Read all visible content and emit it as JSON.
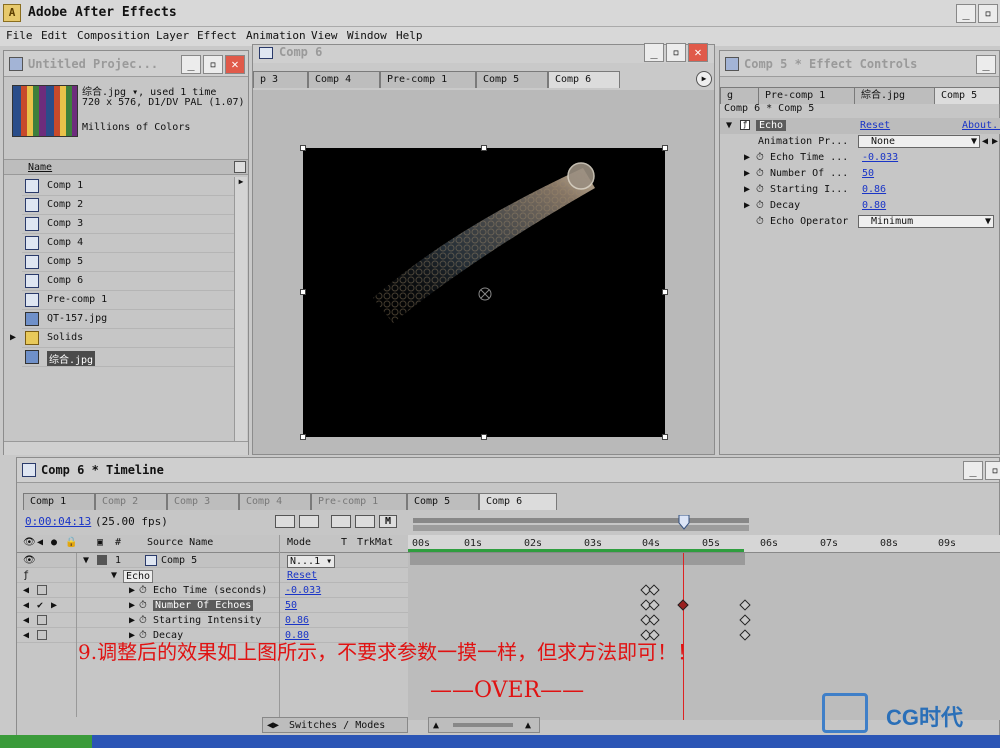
{
  "app": {
    "title": "Adobe After Effects"
  },
  "menu": [
    "File",
    "Edit",
    "Composition",
    "Layer",
    "Effect",
    "Animation",
    "View",
    "Window",
    "Help"
  ],
  "project": {
    "title": "Untitled Projec...",
    "thumb_line1": "综合.jpg ▾, used 1 time",
    "thumb_line2": "720 x 576, D1/DV PAL (1.07)",
    "thumb_line3": "Millions of Colors",
    "col_name": "Name",
    "items": [
      "Comp 1",
      "Comp 2",
      "Comp 3",
      "Comp 4",
      "Comp 5",
      "Comp 6",
      "Pre-comp 1",
      "QT-157.jpg",
      "Solids",
      "综合.jpg"
    ]
  },
  "viewer": {
    "title": "Comp 6",
    "tabs": [
      "p 3",
      "Comp 4",
      "Pre-comp 1",
      "Comp 5",
      "Comp 6"
    ]
  },
  "effect": {
    "title": "Comp 5 * Effect Controls",
    "tabs": [
      "g",
      "Pre-comp 1",
      "綜合.jpg",
      "Comp 5"
    ],
    "breadcrumb": "Comp 6 * Comp 5",
    "effect_name": "Echo",
    "reset": "Reset",
    "about": "About...",
    "rows": [
      {
        "label": "Animation Pr...",
        "value": "None",
        "kind": "dropdown"
      },
      {
        "label": "Echo Time ...",
        "value": "-0.033",
        "kind": "value"
      },
      {
        "label": "Number Of ...",
        "value": "50",
        "kind": "value"
      },
      {
        "label": "Starting I...",
        "value": "0.86",
        "kind": "value"
      },
      {
        "label": "Decay",
        "value": "0.80",
        "kind": "value"
      },
      {
        "label": "Echo Operator",
        "value": "Minimum",
        "kind": "dropdown"
      }
    ]
  },
  "timeline": {
    "title": "Comp 6 * Timeline",
    "tabs": [
      "Comp 1",
      "Comp 2",
      "Comp 3",
      "Comp 4",
      "Pre-comp 1",
      "Comp 5",
      "Comp 6"
    ],
    "timecode": "0:00:04:13",
    "fps": "(25.00 fps)",
    "col_source": "Source Name",
    "col_mode": "Mode",
    "col_t": "T",
    "col_trkmat": "TrkMat",
    "hash": "#",
    "layer_num": "1",
    "layer_name": "Comp 5",
    "layer_mode": "N...1 ▾",
    "effect_name": "Echo",
    "reset": "Reset",
    "props": [
      {
        "name": "Echo Time (seconds)",
        "value": "-0.033"
      },
      {
        "name": "Number Of Echoes",
        "value": "50"
      },
      {
        "name": "Starting Intensity",
        "value": "0.86"
      },
      {
        "name": "Decay",
        "value": "0.80"
      }
    ],
    "ruler": [
      "00s",
      "01s",
      "02s",
      "03s",
      "04s",
      "05s",
      "06s",
      "07s",
      "08s",
      "09s"
    ],
    "switches": "Switches / Modes"
  },
  "overlay": {
    "note": "9.调整后的效果如上图所示，不要求参数一摸一样，但求方法即可！！",
    "over": "——OVER——",
    "brand": "CG时代"
  }
}
